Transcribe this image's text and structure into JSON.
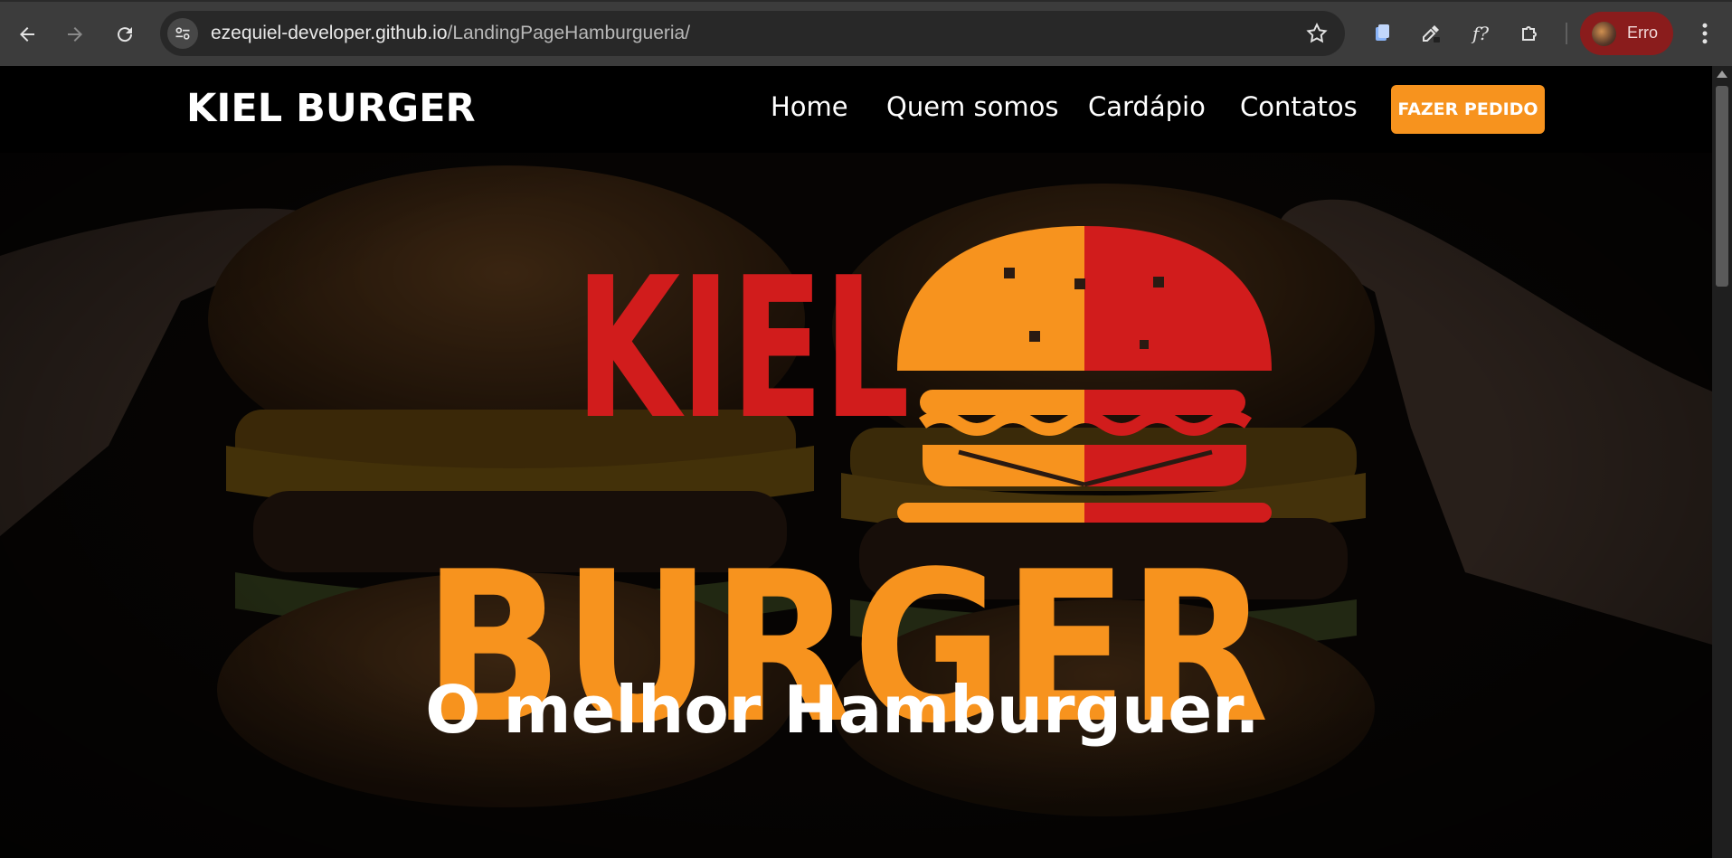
{
  "browser": {
    "url_host": "ezequiel-developer.github.io",
    "url_path": "/LandingPageHamburgueria/",
    "profile_name": "Erro",
    "icons": {
      "back": "back-arrow-icon",
      "forward": "forward-arrow-icon",
      "reload": "reload-icon",
      "site_info": "site-settings-icon",
      "bookmark": "star-icon",
      "ext1": "document-copy-icon",
      "ext2": "eyedropper-icon",
      "ext3": "font-identifier-icon",
      "extensions": "puzzle-icon",
      "menu": "more-vertical-icon"
    }
  },
  "site": {
    "brand": "KIEL BURGER",
    "nav": [
      "Home",
      "Quem somos",
      "Cardápio",
      "Contatos"
    ],
    "cta": "FAZER PEDIDO",
    "logo_text_top": "KIEL",
    "logo_text_bottom": "BURGER",
    "tagline": "O melhor Hamburguer.",
    "colors": {
      "orange": "#f7931e",
      "red": "#d11c1c",
      "header": "#000000"
    }
  }
}
